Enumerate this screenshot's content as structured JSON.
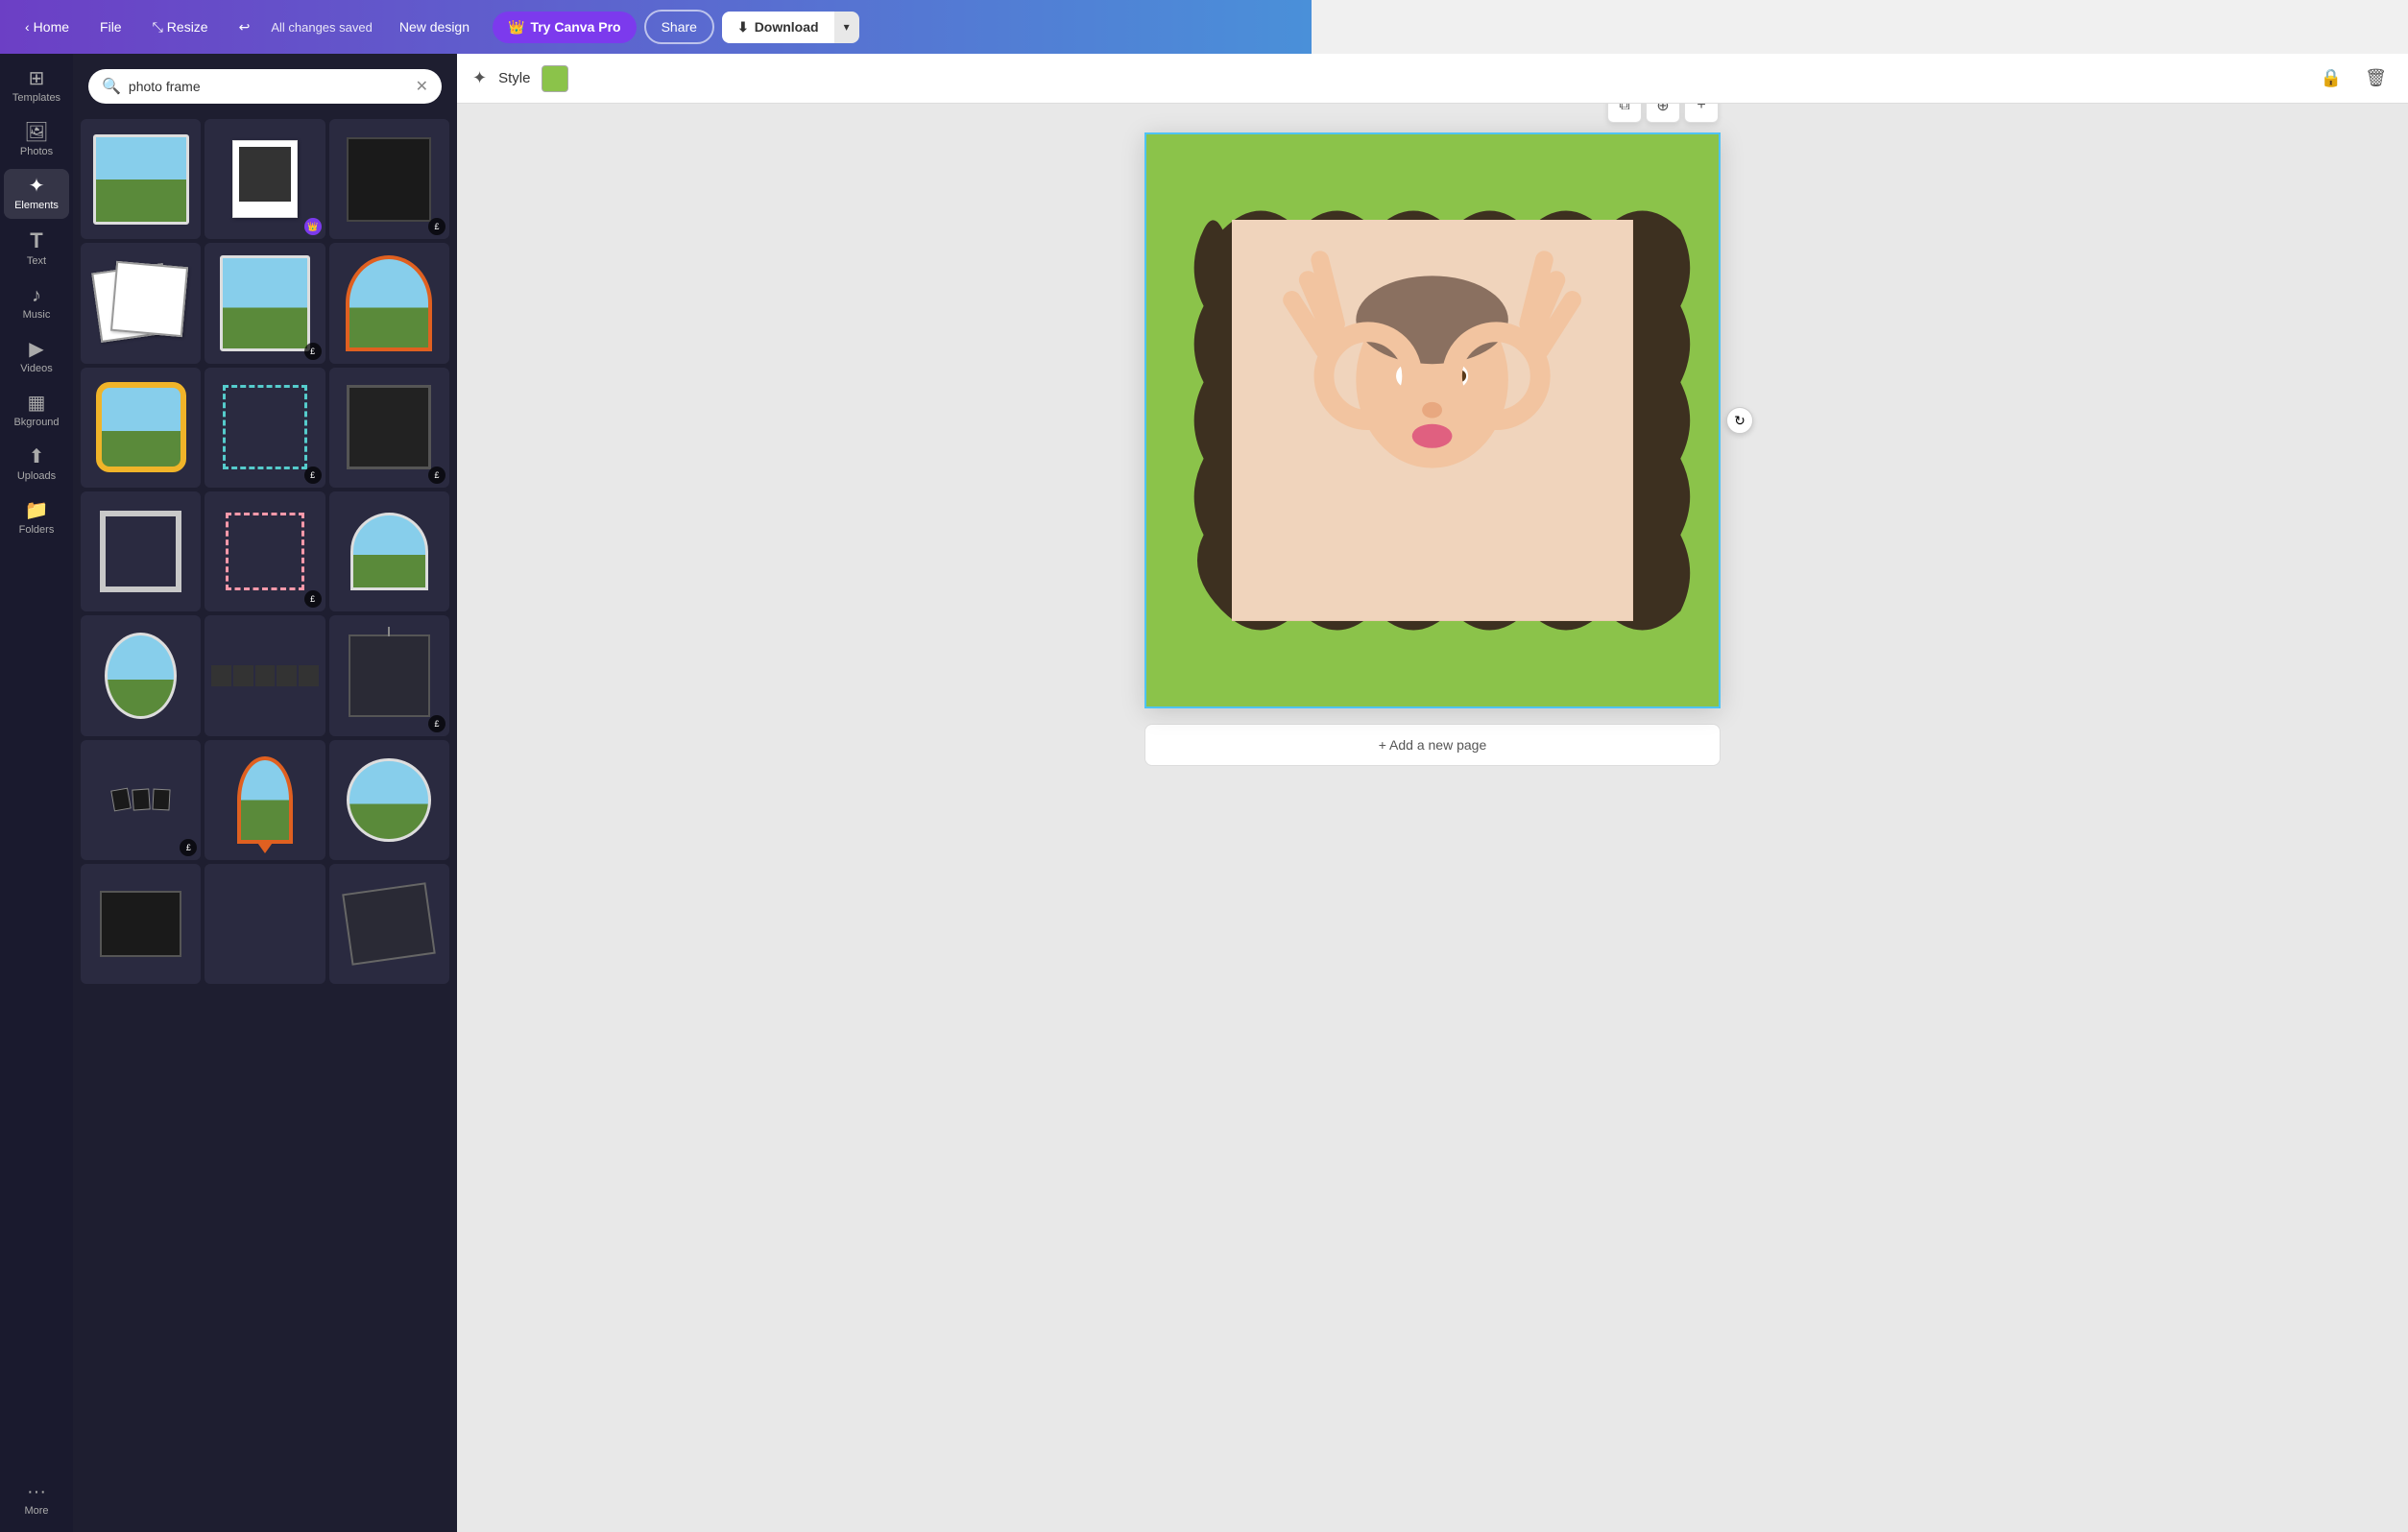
{
  "navbar": {
    "home_label": "Home",
    "file_label": "File",
    "resize_label": "Resize",
    "saved_status": "All changes saved",
    "new_design_label": "New design",
    "try_pro_label": "Try Canva Pro",
    "share_label": "Share",
    "download_label": "Download"
  },
  "sidebar": {
    "items": [
      {
        "id": "templates",
        "label": "Templates",
        "icon": "⊞"
      },
      {
        "id": "photos",
        "label": "Photos",
        "icon": "🖼"
      },
      {
        "id": "elements",
        "label": "Elements",
        "icon": "✦"
      },
      {
        "id": "text",
        "label": "Text",
        "icon": "T"
      },
      {
        "id": "music",
        "label": "Music",
        "icon": "♪"
      },
      {
        "id": "videos",
        "label": "Videos",
        "icon": "▶"
      },
      {
        "id": "background",
        "label": "Bkground",
        "icon": "▦"
      },
      {
        "id": "uploads",
        "label": "Uploads",
        "icon": "↑"
      },
      {
        "id": "folders",
        "label": "Folders",
        "icon": "📁"
      },
      {
        "id": "more",
        "label": "More",
        "icon": "···"
      }
    ]
  },
  "search": {
    "placeholder": "photo frame",
    "value": "photo frame"
  },
  "style_toolbar": {
    "style_label": "Style",
    "color_value": "#8bc34a"
  },
  "canvas": {
    "background_color": "#8bc34a",
    "frame_color": "#3d3020",
    "add_page_label": "+ Add a new page"
  },
  "frames": [
    {
      "id": "f1",
      "type": "landscape",
      "badge": ""
    },
    {
      "id": "f2",
      "type": "polaroid",
      "badge": "crown"
    },
    {
      "id": "f3",
      "type": "black-sq",
      "badge": "£"
    },
    {
      "id": "f4",
      "type": "stack",
      "badge": ""
    },
    {
      "id": "f5",
      "type": "landscape2",
      "badge": "£"
    },
    {
      "id": "f6",
      "type": "orange-circle",
      "badge": ""
    },
    {
      "id": "f7",
      "type": "gold",
      "badge": ""
    },
    {
      "id": "f8",
      "type": "dotted",
      "badge": "£"
    },
    {
      "id": "f9",
      "type": "dark-sq",
      "badge": "£"
    },
    {
      "id": "f10",
      "type": "square-frame",
      "badge": ""
    },
    {
      "id": "f11",
      "type": "dotted-pink",
      "badge": "£"
    },
    {
      "id": "f12",
      "type": "half-circle",
      "badge": ""
    },
    {
      "id": "f13",
      "type": "oval",
      "badge": ""
    },
    {
      "id": "f14",
      "type": "pano",
      "badge": ""
    },
    {
      "id": "f15",
      "type": "hanger",
      "badge": "£"
    },
    {
      "id": "f16",
      "type": "multi-photo",
      "badge": "£"
    },
    {
      "id": "f17",
      "type": "pin-map",
      "badge": ""
    },
    {
      "id": "f18",
      "type": "circle-landscape",
      "badge": ""
    }
  ]
}
